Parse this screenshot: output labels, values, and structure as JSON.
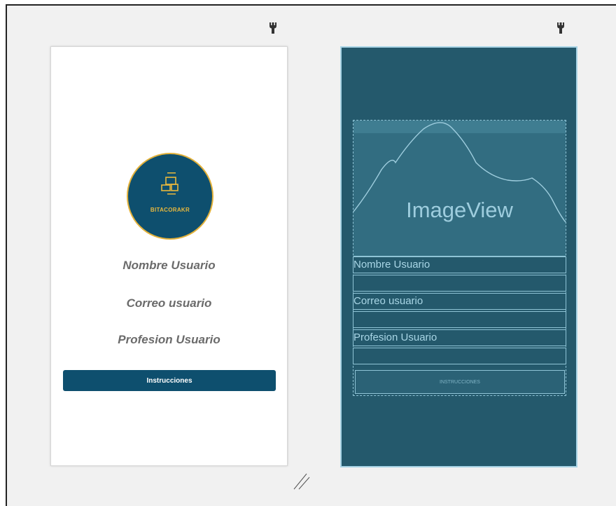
{
  "design": {
    "logo_text": "BITACORAKR",
    "field_name": "Nombre Usuario",
    "field_email": "Correo usuario",
    "field_profession": "Profesion Usuario",
    "button_label": "Instrucciones"
  },
  "blueprint": {
    "image_label": "ImageView",
    "field_name": "Nombre Usuario",
    "field_email": "Correo usuario",
    "field_profession": "Profesion Usuario",
    "button_label": "INSTRUCCIONES"
  },
  "icons": [
    "wrench-icon",
    "wrench-icon",
    "device-icon",
    "resize-handle-icon"
  ],
  "colors": {
    "brand_primary": "#0e4f6e",
    "logo_gold": "#e2b13a",
    "blueprint_bg": "#24596c",
    "blueprint_line": "#8fc4d6"
  }
}
